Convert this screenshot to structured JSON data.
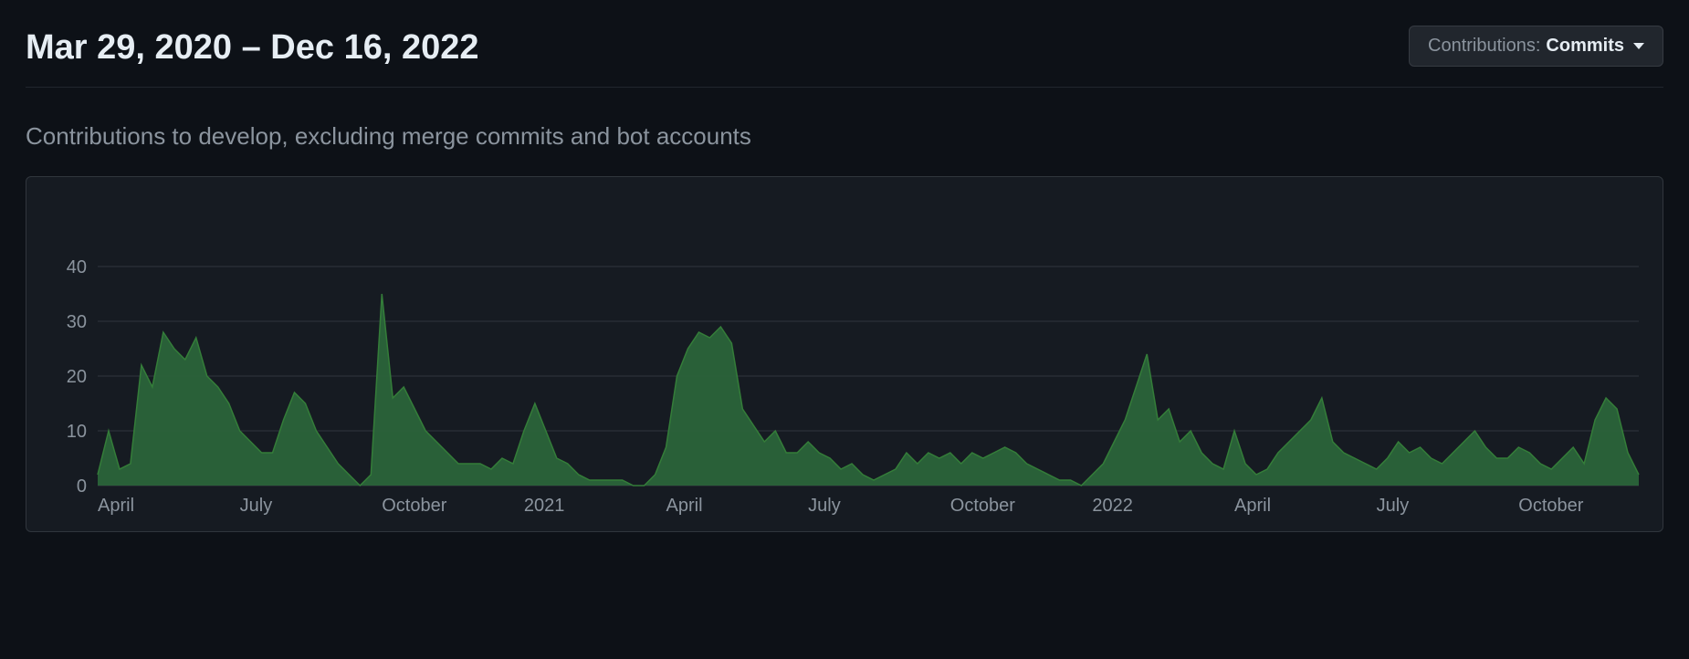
{
  "header": {
    "title": "Mar 29, 2020 – Dec 16, 2022",
    "dropdown_label": "Contributions:",
    "dropdown_value": "Commits"
  },
  "subtitle": "Contributions to develop, excluding merge commits and bot accounts",
  "chart_data": {
    "type": "area",
    "title": "",
    "xlabel": "",
    "ylabel": "",
    "ylim": [
      0,
      45
    ],
    "y_ticks": [
      0,
      10,
      20,
      30,
      40
    ],
    "x_ticks": [
      "April",
      "July",
      "October",
      "2021",
      "April",
      "July",
      "October",
      "2022",
      "April",
      "July",
      "October"
    ],
    "x": [
      0,
      1,
      2,
      3,
      4,
      5,
      6,
      7,
      8,
      9,
      10,
      11,
      12,
      13,
      14,
      15,
      16,
      17,
      18,
      19,
      20,
      21,
      22,
      23,
      24,
      25,
      26,
      27,
      28,
      29,
      30,
      31,
      32,
      33,
      34,
      35,
      36,
      37,
      38,
      39,
      40,
      41,
      42,
      43,
      44,
      45,
      46,
      47,
      48,
      49,
      50,
      51,
      52,
      53,
      54,
      55,
      56,
      57,
      58,
      59,
      60,
      61,
      62,
      63,
      64,
      65,
      66,
      67,
      68,
      69,
      70,
      71,
      72,
      73,
      74,
      75,
      76,
      77,
      78,
      79,
      80,
      81,
      82,
      83,
      84,
      85,
      86,
      87,
      88,
      89,
      90,
      91,
      92,
      93,
      94,
      95,
      96,
      97,
      98,
      99,
      100,
      101,
      102,
      103,
      104,
      105,
      106,
      107,
      108,
      109,
      110,
      111,
      112,
      113,
      114,
      115,
      116,
      117,
      118,
      119,
      120,
      121,
      122,
      123,
      124,
      125,
      126,
      127,
      128,
      129,
      130,
      131,
      132,
      133,
      134,
      135,
      136,
      137,
      138,
      139,
      140,
      141
    ],
    "series": [
      {
        "name": "Commits",
        "values": [
          2,
          10,
          3,
          4,
          22,
          18,
          28,
          25,
          23,
          27,
          20,
          18,
          15,
          10,
          8,
          6,
          6,
          12,
          17,
          15,
          10,
          7,
          4,
          2,
          0,
          2,
          35,
          16,
          18,
          14,
          10,
          8,
          6,
          4,
          4,
          4,
          3,
          5,
          4,
          10,
          15,
          10,
          5,
          4,
          2,
          1,
          1,
          1,
          1,
          0,
          0,
          2,
          7,
          20,
          25,
          28,
          27,
          29,
          26,
          14,
          11,
          8,
          10,
          6,
          6,
          8,
          6,
          5,
          3,
          4,
          2,
          1,
          2,
          3,
          6,
          4,
          6,
          5,
          6,
          4,
          6,
          5,
          6,
          7,
          6,
          4,
          3,
          2,
          1,
          1,
          0,
          2,
          4,
          8,
          12,
          18,
          24,
          12,
          14,
          8,
          10,
          6,
          4,
          3,
          10,
          4,
          2,
          3,
          6,
          8,
          10,
          12,
          16,
          8,
          6,
          5,
          4,
          3,
          5,
          8,
          6,
          7,
          5,
          4,
          6,
          8,
          10,
          7,
          5,
          5,
          7,
          6,
          4,
          3,
          5,
          7,
          4,
          12,
          16,
          14,
          6,
          2
        ]
      }
    ]
  }
}
